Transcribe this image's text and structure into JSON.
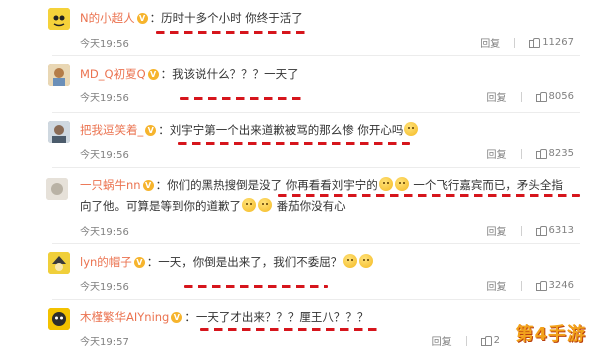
{
  "comments": [
    {
      "username": "N的小超人",
      "badge": "V",
      "text": "历时十多个小时 你终于活了",
      "time": "今天19:56",
      "reply": "回复",
      "likes": "11267",
      "avatar_color": "#f0c419"
    },
    {
      "username": "MD_Q初夏Q",
      "badge": "V",
      "text": "我该说什么？？？一天了",
      "time": "今天19:56",
      "reply": "回复",
      "likes": "8056",
      "avatar_color": "#c9a36a"
    },
    {
      "username": "把我逗笑着_",
      "badge": "V",
      "text": "刘宇宁第一个出来道歉被骂的那么惨 你开心吗",
      "time": "今天19:56",
      "reply": "回复",
      "likes": "8235",
      "avatar_color": "#7a8a9a"
    },
    {
      "username": "一只蜗牛nn",
      "badge": "V",
      "text_a": "你们的黑热搜倒是没了 你再看看刘宇宁的",
      "text_b": "一个飞行嘉宾而已，矛头全指",
      "text_c": "向了他。可算是等到你的道歉了",
      "text_d": "番茄你没有心",
      "time": "今天19:56",
      "reply": "回复",
      "likes": "6313",
      "avatar_color": "#d9d4cc"
    },
    {
      "username": "lyn的帽子",
      "badge": "V",
      "text": "一天，你倒是出来了，我们不委屈？",
      "time": "今天19:56",
      "reply": "回复",
      "likes": "3246",
      "avatar_color": "#e8c21a"
    },
    {
      "username": "木槿繁华AIYning",
      "badge": "V",
      "text": "一天了才出来？？？厘王八？？？",
      "time": "今天19:57",
      "reply": "回复",
      "likes": "2",
      "avatar_color": "#e2b400"
    }
  ],
  "watermark": "第4手游",
  "colors": {
    "username": "#eb7350",
    "underline": "#d6151c",
    "meta": "#808080"
  },
  "icons": {
    "like": "thumbs-up-icon",
    "badge": "verified-badge-icon"
  }
}
